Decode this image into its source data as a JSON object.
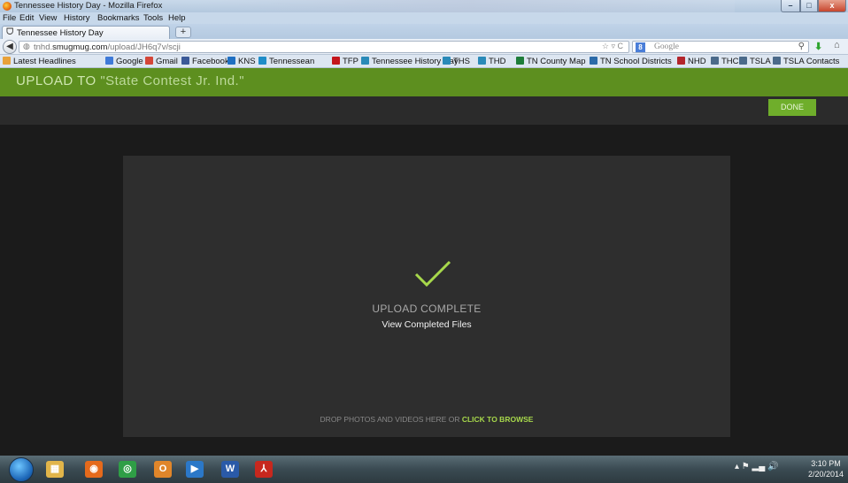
{
  "window": {
    "title": "Tennessee History Day - Mozilla Firefox",
    "min_glyph": "–",
    "max_glyph": "□",
    "close_glyph": "x"
  },
  "menu": [
    "File",
    "Edit",
    "View",
    "History",
    "Bookmarks",
    "Tools",
    "Help"
  ],
  "tabs": {
    "active_label": "Tennessee History Day",
    "active_icon": "ᗜ",
    "new_tab_glyph": "+"
  },
  "nav": {
    "back_glyph": "◀",
    "url_host": "tnhd.",
    "url_domain": "smugmug.com",
    "url_path": "/upload/JH6q7v/scji",
    "url_icons": "☆ ▿ C",
    "search_engine_glyph": "8",
    "search_placeholder": "Google",
    "search_icon": "⚲",
    "download_icon": "⬇",
    "home_icon": "⌂"
  },
  "bookmarks": [
    {
      "label": "Latest Headlines",
      "icon": "rss-icon",
      "color": "#e8a13a"
    },
    {
      "label": "Google",
      "icon": "google-icon",
      "color": "#3f7ad8"
    },
    {
      "label": "Gmail",
      "icon": "gmail-icon",
      "color": "#d44638"
    },
    {
      "label": "Facebook",
      "icon": "facebook-icon",
      "color": "#3b5998"
    },
    {
      "label": "KNS",
      "icon": "kns-icon",
      "color": "#1f6fc2"
    },
    {
      "label": "Tennessean",
      "icon": "tennessean-icon",
      "color": "#1f8dc8"
    },
    {
      "label": "TFP",
      "icon": "tfp-icon",
      "color": "#c4161c"
    },
    {
      "label": "Tennessee History Day",
      "icon": "globe-icon",
      "color": "#2a8ab8"
    },
    {
      "label": "THS",
      "icon": "globe-icon",
      "color": "#2a8ab8"
    },
    {
      "label": "THD",
      "icon": "globe-icon",
      "color": "#2a8ab8"
    },
    {
      "label": "TN County Map",
      "icon": "earth-icon",
      "color": "#1e7d3a"
    },
    {
      "label": "TN School Districts",
      "icon": "schools-icon",
      "color": "#2b6aa8"
    },
    {
      "label": "NHD",
      "icon": "flag-icon",
      "color": "#b3252b"
    },
    {
      "label": "THC",
      "icon": "gear-icon",
      "color": "#4b6a8a"
    },
    {
      "label": "TSLA",
      "icon": "gear-icon",
      "color": "#4b6a8a"
    },
    {
      "label": "TSLA Contacts",
      "icon": "gear-icon",
      "color": "#4b6a8a"
    }
  ],
  "upload": {
    "title_prefix": "UPLOAD TO",
    "album_name": "\"State Contest Jr. Ind.\"",
    "done_label": "DONE",
    "complete_label": "UPLOAD COMPLETE",
    "view_files_label": "View Completed Files",
    "drop_hint": "DROP PHOTOS AND VIDEOS HERE OR",
    "browse_label": "CLICK TO BROWSE",
    "accent_color": "#a7d84b",
    "header_color": "#5d8f1f"
  },
  "taskbar": {
    "apps": [
      {
        "name": "explorer-icon",
        "glyph": "▦",
        "color": "#e1b54a"
      },
      {
        "name": "firefox-icon",
        "glyph": "◉",
        "color": "#e56a1c"
      },
      {
        "name": "chrome-icon",
        "glyph": "◎",
        "color": "#2f9e46"
      },
      {
        "name": "outlook-icon",
        "glyph": "O",
        "color": "#e0862a"
      },
      {
        "name": "media-player-icon",
        "glyph": "▶",
        "color": "#2b78c8"
      },
      {
        "name": "word-icon",
        "glyph": "W",
        "color": "#2a5aa8"
      },
      {
        "name": "acrobat-icon",
        "glyph": "⅄",
        "color": "#c7281e"
      }
    ],
    "tray_glyphs": "▴ ⚑ ▂▄ 🔊",
    "time": "3:10 PM",
    "date": "2/20/2014"
  }
}
